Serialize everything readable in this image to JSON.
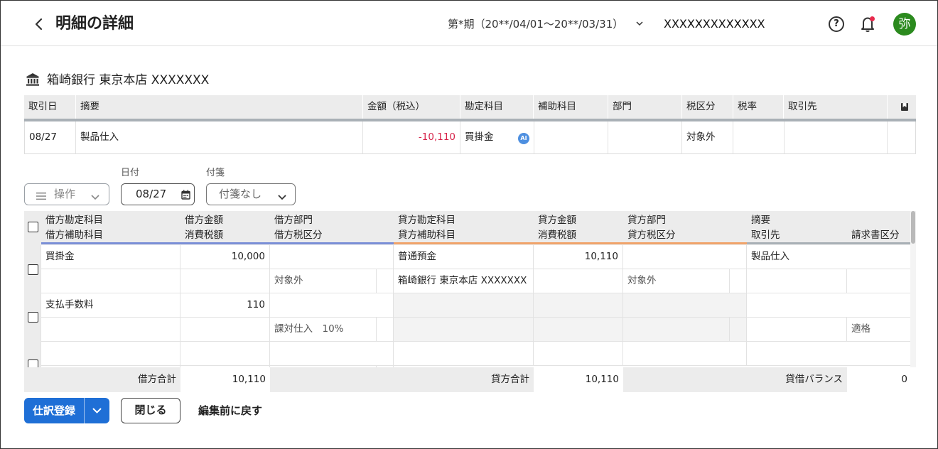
{
  "header": {
    "back_icon": "chevron-left-icon",
    "title": "明細の詳細",
    "period": "第*期（20**/04/01〜20**/03/31）",
    "company": "XXXXXXXXXXXXX",
    "avatar_text": "弥",
    "colors": {
      "avatar": "#2b8a1e",
      "notification_dot": "#e8294c"
    }
  },
  "bank": {
    "icon": "bank-icon",
    "name": "箱崎銀行 東京本店 XXXXXXX"
  },
  "transaction_table": {
    "columns": [
      "取引日",
      "摘要",
      "金額（税込）",
      "勘定科目",
      "補助科目",
      "部門",
      "税区分",
      "税率",
      "取引先"
    ],
    "row": {
      "date": "08/27",
      "description": "製品仕入",
      "amount": "-10,110",
      "account": "買掛金",
      "ai_badge": "AI",
      "sub_account": "",
      "department": "",
      "tax_category": "対象外",
      "tax_rate": "",
      "partner": ""
    },
    "colors": {
      "negative_amount": "#d6244a"
    }
  },
  "controls": {
    "operation_label": "操作",
    "date_label": "日付",
    "date_value": "08/27",
    "tag_label": "付箋",
    "tag_value": "付箋なし"
  },
  "journal": {
    "header_row1": [
      "借方勘定科目",
      "借方金額",
      "借方部門",
      "貸方勘定科目",
      "貸方金額",
      "貸方部門",
      "摘要"
    ],
    "header_row2": [
      "借方補助科目",
      "消費税額",
      "借方税区分",
      "貸方補助科目",
      "消費税額",
      "貸方税区分",
      "取引先",
      "請求書区分"
    ],
    "rows": [
      {
        "debit_account": "買掛金",
        "debit_amount": "10,000",
        "debit_dept": "",
        "credit_account": "普通預金",
        "credit_amount": "10,110",
        "credit_dept": "",
        "memo": "製品仕入",
        "debit_sub": "",
        "debit_tax_amount": "",
        "debit_tax_category": "対象外",
        "credit_sub": "箱崎銀行 東京本店 XXXXXXX",
        "credit_tax_amount": "",
        "credit_tax_category": "対象外",
        "partner": "",
        "invoice_type": ""
      },
      {
        "debit_account": "支払手数料",
        "debit_amount": "110",
        "debit_dept": "",
        "credit_account": "",
        "credit_amount": "",
        "credit_dept": "",
        "memo": "",
        "debit_sub": "",
        "debit_tax_amount": "",
        "debit_tax_category": "課対仕入　10%",
        "credit_sub": "",
        "credit_tax_amount": "",
        "credit_tax_category": "",
        "partner": "",
        "invoice_type": "適格"
      }
    ],
    "footer": {
      "debit_total_label": "借方合計",
      "debit_total": "10,110",
      "credit_total_label": "貸方合計",
      "credit_total": "10,110",
      "balance_label": "貸借バランス",
      "balance": "0"
    },
    "colors": {
      "debit_accent": "#7b8fd6",
      "credit_accent": "#f0a46b",
      "memo_accent": "#a9b0b6"
    }
  },
  "actions": {
    "register": "仕訳登録",
    "close": "閉じる",
    "revert": "編集前に戻す",
    "colors": {
      "primary": "#1f6fd6"
    }
  }
}
